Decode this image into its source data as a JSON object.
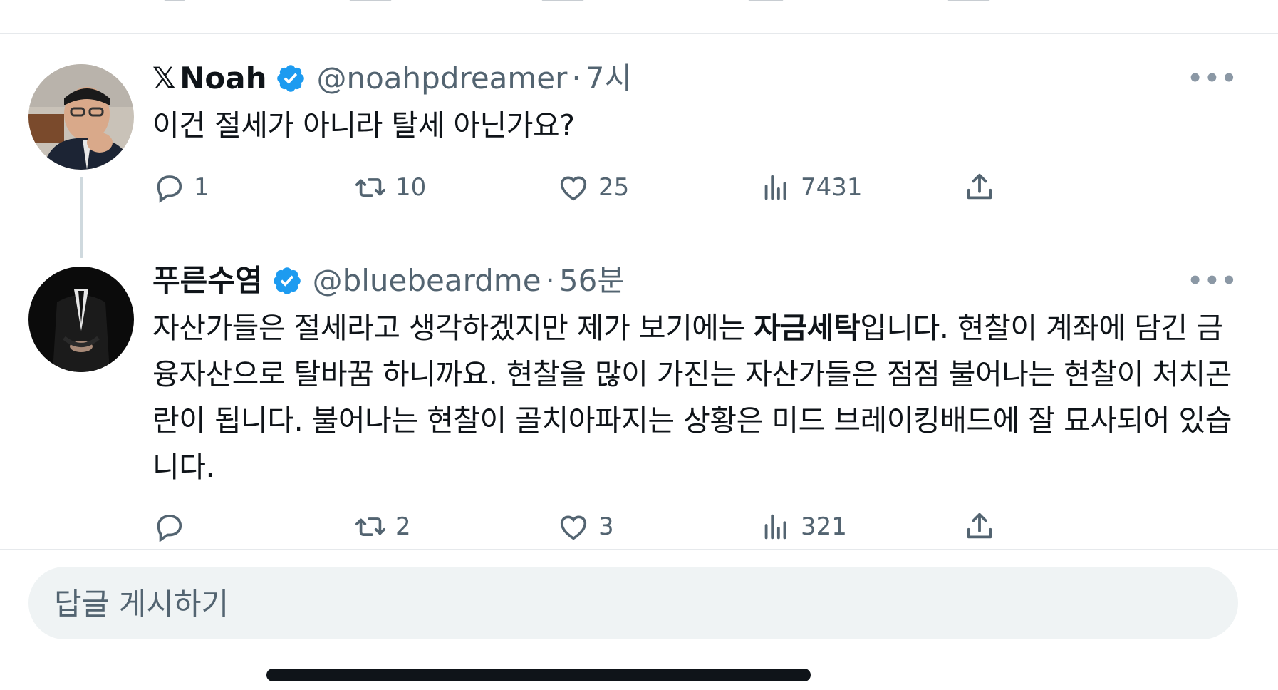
{
  "tweets": [
    {
      "name": "Noah",
      "handle": "@noahpdreamer",
      "separator": "·",
      "time": "7시",
      "text": "이건 절세가 아니라 탈세 아닌가요?",
      "stats": {
        "replies": "1",
        "retweets": "10",
        "likes": "25",
        "views": "7431"
      }
    },
    {
      "name": "푸른수염",
      "handle": "@bluebeardme",
      "separator": "·",
      "time": "56분",
      "text_parts": {
        "before_bold": "자산가들은 절세라고 생각하겠지만 제가 보기에는 ",
        "bold": "자금세탁",
        "after_bold": "입니다. 현찰이 계좌에 담긴 금융자산으로 탈바꿈 하니까요. 현찰을 많이 가진는 자산가들은 점점 불어나는 현찰이 처치곤란이 됩니다. 불어나는 현찰이 골치아파지는 상황은 미드 브레이킹배드에 잘 묘사되어 있습니다."
      },
      "stats": {
        "replies": "",
        "retweets": "2",
        "likes": "3",
        "views": "321"
      }
    }
  ],
  "more_label": "•••",
  "reply_box": {
    "placeholder": "답글 게시하기"
  },
  "icons": {
    "x_logo": "𝕏",
    "verified": "verified-badge-icon",
    "reply": "reply-icon",
    "retweet": "retweet-icon",
    "like": "heart-icon",
    "views": "views-icon",
    "share": "share-icon"
  },
  "colors": {
    "verified_blue": "#1d9bf0",
    "secondary_text": "#536471",
    "reply_box_bg": "#eff3f4"
  }
}
